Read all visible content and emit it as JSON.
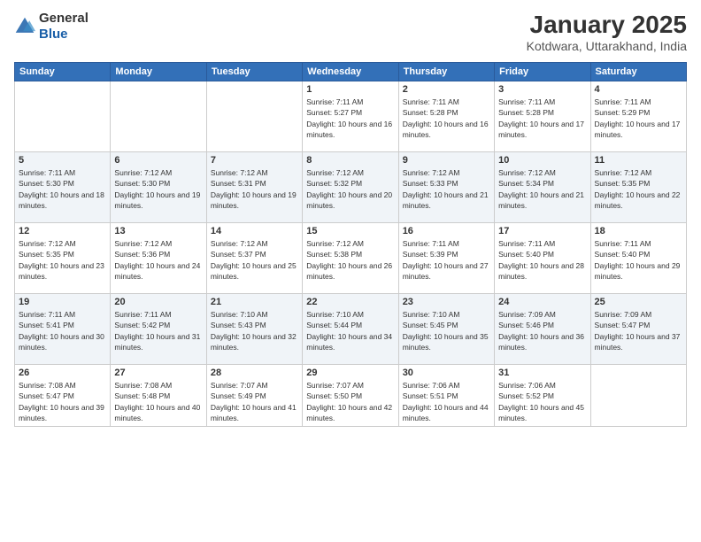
{
  "logo": {
    "general": "General",
    "blue": "Blue"
  },
  "title": "January 2025",
  "location": "Kotdwara, Uttarakhand, India",
  "days_of_week": [
    "Sunday",
    "Monday",
    "Tuesday",
    "Wednesday",
    "Thursday",
    "Friday",
    "Saturday"
  ],
  "weeks": [
    [
      {
        "day": "",
        "sunrise": "",
        "sunset": "",
        "daylight": ""
      },
      {
        "day": "",
        "sunrise": "",
        "sunset": "",
        "daylight": ""
      },
      {
        "day": "",
        "sunrise": "",
        "sunset": "",
        "daylight": ""
      },
      {
        "day": "1",
        "sunrise": "Sunrise: 7:11 AM",
        "sunset": "Sunset: 5:27 PM",
        "daylight": "Daylight: 10 hours and 16 minutes."
      },
      {
        "day": "2",
        "sunrise": "Sunrise: 7:11 AM",
        "sunset": "Sunset: 5:28 PM",
        "daylight": "Daylight: 10 hours and 16 minutes."
      },
      {
        "day": "3",
        "sunrise": "Sunrise: 7:11 AM",
        "sunset": "Sunset: 5:28 PM",
        "daylight": "Daylight: 10 hours and 17 minutes."
      },
      {
        "day": "4",
        "sunrise": "Sunrise: 7:11 AM",
        "sunset": "Sunset: 5:29 PM",
        "daylight": "Daylight: 10 hours and 17 minutes."
      }
    ],
    [
      {
        "day": "5",
        "sunrise": "Sunrise: 7:11 AM",
        "sunset": "Sunset: 5:30 PM",
        "daylight": "Daylight: 10 hours and 18 minutes."
      },
      {
        "day": "6",
        "sunrise": "Sunrise: 7:12 AM",
        "sunset": "Sunset: 5:30 PM",
        "daylight": "Daylight: 10 hours and 19 minutes."
      },
      {
        "day": "7",
        "sunrise": "Sunrise: 7:12 AM",
        "sunset": "Sunset: 5:31 PM",
        "daylight": "Daylight: 10 hours and 19 minutes."
      },
      {
        "day": "8",
        "sunrise": "Sunrise: 7:12 AM",
        "sunset": "Sunset: 5:32 PM",
        "daylight": "Daylight: 10 hours and 20 minutes."
      },
      {
        "day": "9",
        "sunrise": "Sunrise: 7:12 AM",
        "sunset": "Sunset: 5:33 PM",
        "daylight": "Daylight: 10 hours and 21 minutes."
      },
      {
        "day": "10",
        "sunrise": "Sunrise: 7:12 AM",
        "sunset": "Sunset: 5:34 PM",
        "daylight": "Daylight: 10 hours and 21 minutes."
      },
      {
        "day": "11",
        "sunrise": "Sunrise: 7:12 AM",
        "sunset": "Sunset: 5:35 PM",
        "daylight": "Daylight: 10 hours and 22 minutes."
      }
    ],
    [
      {
        "day": "12",
        "sunrise": "Sunrise: 7:12 AM",
        "sunset": "Sunset: 5:35 PM",
        "daylight": "Daylight: 10 hours and 23 minutes."
      },
      {
        "day": "13",
        "sunrise": "Sunrise: 7:12 AM",
        "sunset": "Sunset: 5:36 PM",
        "daylight": "Daylight: 10 hours and 24 minutes."
      },
      {
        "day": "14",
        "sunrise": "Sunrise: 7:12 AM",
        "sunset": "Sunset: 5:37 PM",
        "daylight": "Daylight: 10 hours and 25 minutes."
      },
      {
        "day": "15",
        "sunrise": "Sunrise: 7:12 AM",
        "sunset": "Sunset: 5:38 PM",
        "daylight": "Daylight: 10 hours and 26 minutes."
      },
      {
        "day": "16",
        "sunrise": "Sunrise: 7:11 AM",
        "sunset": "Sunset: 5:39 PM",
        "daylight": "Daylight: 10 hours and 27 minutes."
      },
      {
        "day": "17",
        "sunrise": "Sunrise: 7:11 AM",
        "sunset": "Sunset: 5:40 PM",
        "daylight": "Daylight: 10 hours and 28 minutes."
      },
      {
        "day": "18",
        "sunrise": "Sunrise: 7:11 AM",
        "sunset": "Sunset: 5:40 PM",
        "daylight": "Daylight: 10 hours and 29 minutes."
      }
    ],
    [
      {
        "day": "19",
        "sunrise": "Sunrise: 7:11 AM",
        "sunset": "Sunset: 5:41 PM",
        "daylight": "Daylight: 10 hours and 30 minutes."
      },
      {
        "day": "20",
        "sunrise": "Sunrise: 7:11 AM",
        "sunset": "Sunset: 5:42 PM",
        "daylight": "Daylight: 10 hours and 31 minutes."
      },
      {
        "day": "21",
        "sunrise": "Sunrise: 7:10 AM",
        "sunset": "Sunset: 5:43 PM",
        "daylight": "Daylight: 10 hours and 32 minutes."
      },
      {
        "day": "22",
        "sunrise": "Sunrise: 7:10 AM",
        "sunset": "Sunset: 5:44 PM",
        "daylight": "Daylight: 10 hours and 34 minutes."
      },
      {
        "day": "23",
        "sunrise": "Sunrise: 7:10 AM",
        "sunset": "Sunset: 5:45 PM",
        "daylight": "Daylight: 10 hours and 35 minutes."
      },
      {
        "day": "24",
        "sunrise": "Sunrise: 7:09 AM",
        "sunset": "Sunset: 5:46 PM",
        "daylight": "Daylight: 10 hours and 36 minutes."
      },
      {
        "day": "25",
        "sunrise": "Sunrise: 7:09 AM",
        "sunset": "Sunset: 5:47 PM",
        "daylight": "Daylight: 10 hours and 37 minutes."
      }
    ],
    [
      {
        "day": "26",
        "sunrise": "Sunrise: 7:08 AM",
        "sunset": "Sunset: 5:47 PM",
        "daylight": "Daylight: 10 hours and 39 minutes."
      },
      {
        "day": "27",
        "sunrise": "Sunrise: 7:08 AM",
        "sunset": "Sunset: 5:48 PM",
        "daylight": "Daylight: 10 hours and 40 minutes."
      },
      {
        "day": "28",
        "sunrise": "Sunrise: 7:07 AM",
        "sunset": "Sunset: 5:49 PM",
        "daylight": "Daylight: 10 hours and 41 minutes."
      },
      {
        "day": "29",
        "sunrise": "Sunrise: 7:07 AM",
        "sunset": "Sunset: 5:50 PM",
        "daylight": "Daylight: 10 hours and 42 minutes."
      },
      {
        "day": "30",
        "sunrise": "Sunrise: 7:06 AM",
        "sunset": "Sunset: 5:51 PM",
        "daylight": "Daylight: 10 hours and 44 minutes."
      },
      {
        "day": "31",
        "sunrise": "Sunrise: 7:06 AM",
        "sunset": "Sunset: 5:52 PM",
        "daylight": "Daylight: 10 hours and 45 minutes."
      },
      {
        "day": "",
        "sunrise": "",
        "sunset": "",
        "daylight": ""
      }
    ]
  ]
}
